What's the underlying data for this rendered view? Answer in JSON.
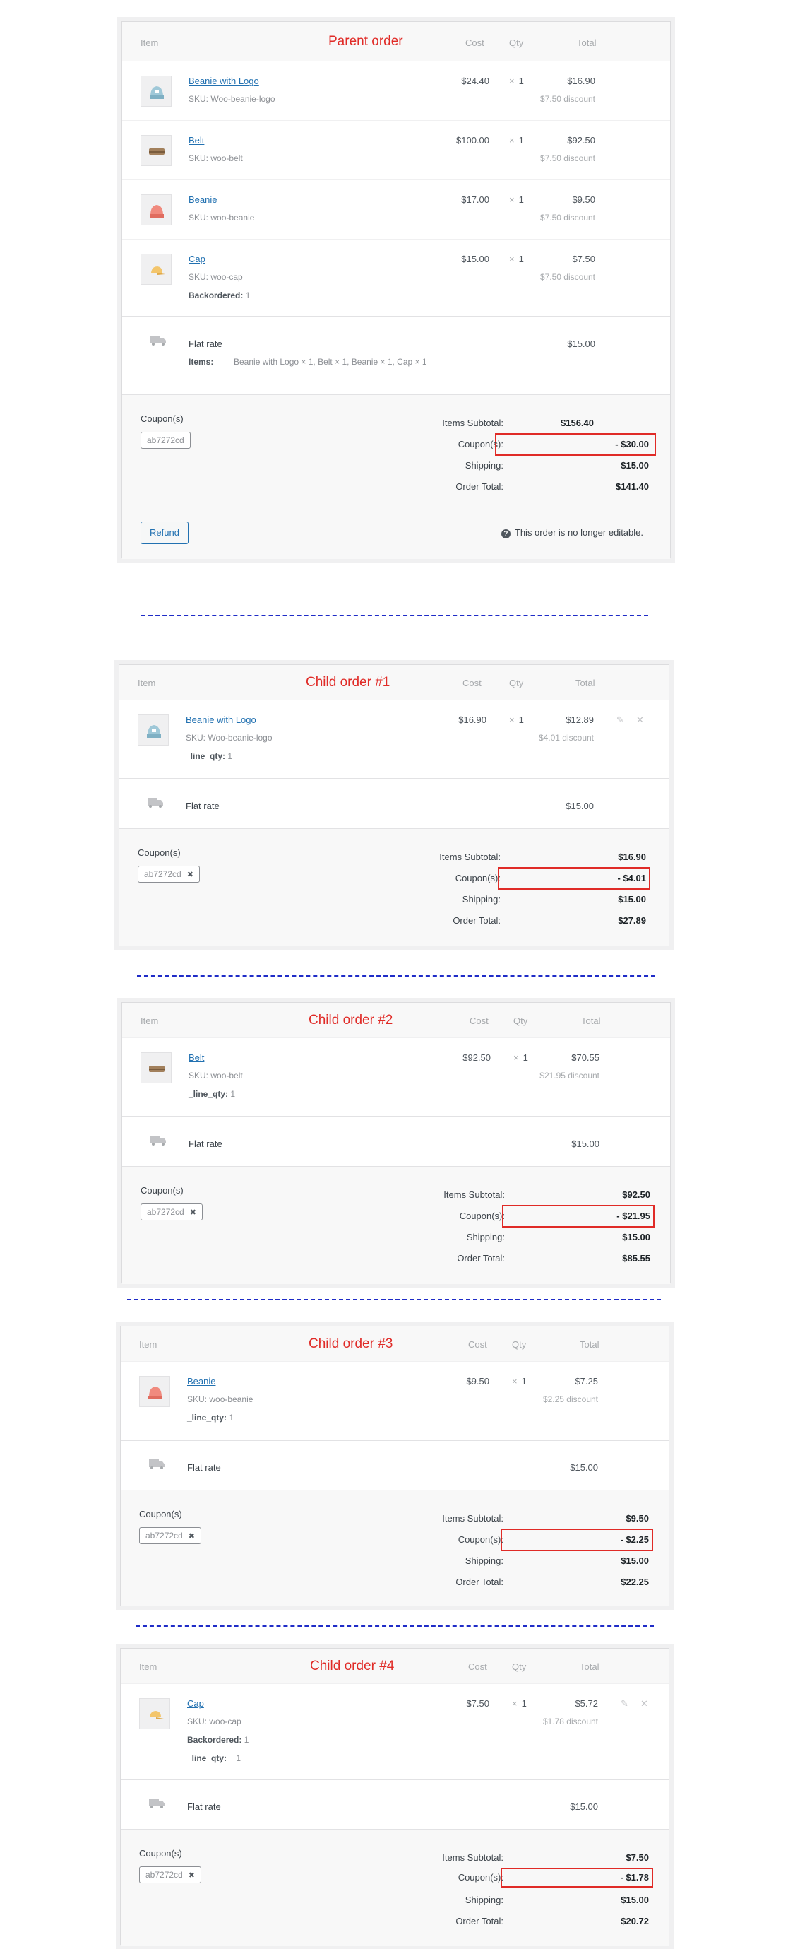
{
  "columns": {
    "item": "Item",
    "cost": "Cost",
    "qty": "Qty",
    "total": "Total"
  },
  "parent": {
    "title": "Parent order",
    "items": [
      {
        "name": "Beanie with Logo",
        "sku_label": "SKU:",
        "sku": "Woo-beanie-logo",
        "cost": "$24.40",
        "qty": "1",
        "total": "$16.90",
        "discount": "$7.50 discount",
        "thumb": "beanie-logo-icon"
      },
      {
        "name": "Belt",
        "sku_label": "SKU:",
        "sku": "woo-belt",
        "cost": "$100.00",
        "qty": "1",
        "total": "$92.50",
        "discount": "$7.50 discount",
        "thumb": "belt-icon"
      },
      {
        "name": "Beanie",
        "sku_label": "SKU:",
        "sku": "woo-beanie",
        "cost": "$17.00",
        "qty": "1",
        "total": "$9.50",
        "discount": "$7.50 discount",
        "thumb": "beanie-icon"
      },
      {
        "name": "Cap",
        "sku_label": "SKU:",
        "sku": "woo-cap",
        "backorder_label": "Backordered:",
        "backorder": "1",
        "cost": "$15.00",
        "qty": "1",
        "total": "$7.50",
        "discount": "$7.50 discount",
        "thumb": "cap-icon"
      }
    ],
    "shipping": {
      "name": "Flat rate",
      "items_label": "Items:",
      "items": "Beanie with Logo × 1, Belt × 1, Beanie × 1, Cap × 1",
      "total": "$15.00"
    },
    "coupons_label": "Coupon(s)",
    "coupon_code": "ab7272cd",
    "totals": {
      "items_subtotal_label": "Items Subtotal:",
      "items_subtotal": "$156.40",
      "coupons_label": "Coupon(s):",
      "coupons": "- $30.00",
      "shipping_label": "Shipping:",
      "shipping": "$15.00",
      "order_total_label": "Order Total:",
      "order_total": "$141.40"
    },
    "refund_label": "Refund",
    "not_editable": "This order is no longer editable."
  },
  "children": [
    {
      "title": "Child order #1",
      "item": {
        "name": "Beanie with Logo",
        "sku_label": "SKU:",
        "sku": "Woo-beanie-logo",
        "line_qty_label": "_line_qty:",
        "line_qty": "1",
        "cost": "$16.90",
        "qty": "1",
        "total": "$12.89",
        "discount": "$4.01 discount",
        "thumb": "beanie-logo-icon"
      },
      "shipping": {
        "name": "Flat rate",
        "total": "$15.00"
      },
      "coupons_label": "Coupon(s)",
      "coupon_code": "ab7272cd",
      "totals": {
        "items_subtotal_label": "Items Subtotal:",
        "items_subtotal": "$16.90",
        "coupons_label": "Coupon(s):",
        "coupons": "- $4.01",
        "shipping_label": "Shipping:",
        "shipping": "$15.00",
        "order_total_label": "Order Total:",
        "order_total": "$27.89"
      }
    },
    {
      "title": "Child order #2",
      "item": {
        "name": "Belt",
        "sku_label": "SKU:",
        "sku": "woo-belt",
        "line_qty_label": "_line_qty:",
        "line_qty": "1",
        "cost": "$92.50",
        "qty": "1",
        "total": "$70.55",
        "discount": "$21.95 discount",
        "thumb": "belt-icon"
      },
      "shipping": {
        "name": "Flat rate",
        "total": "$15.00"
      },
      "coupons_label": "Coupon(s)",
      "coupon_code": "ab7272cd",
      "totals": {
        "items_subtotal_label": "Items Subtotal:",
        "items_subtotal": "$92.50",
        "coupons_label": "Coupon(s):",
        "coupons": "- $21.95",
        "shipping_label": "Shipping:",
        "shipping": "$15.00",
        "order_total_label": "Order Total:",
        "order_total": "$85.55"
      }
    },
    {
      "title": "Child order #3",
      "item": {
        "name": "Beanie",
        "sku_label": "SKU:",
        "sku": "woo-beanie",
        "line_qty_label": "_line_qty:",
        "line_qty": "1",
        "cost": "$9.50",
        "qty": "1",
        "total": "$7.25",
        "discount": "$2.25 discount",
        "thumb": "beanie-icon"
      },
      "shipping": {
        "name": "Flat rate",
        "total": "$15.00"
      },
      "coupons_label": "Coupon(s)",
      "coupon_code": "ab7272cd",
      "totals": {
        "items_subtotal_label": "Items Subtotal:",
        "items_subtotal": "$9.50",
        "coupons_label": "Coupon(s):",
        "coupons": "- $2.25",
        "shipping_label": "Shipping:",
        "shipping": "$15.00",
        "order_total_label": "Order Total:",
        "order_total": "$22.25"
      }
    },
    {
      "title": "Child order #4",
      "item": {
        "name": "Cap",
        "sku_label": "SKU:",
        "sku": "woo-cap",
        "backorder_label": "Backordered:",
        "backorder": "1",
        "line_qty_label": "_line_qty:",
        "line_qty": "1",
        "cost": "$7.50",
        "qty": "1",
        "total": "$5.72",
        "discount": "$1.78 discount",
        "thumb": "cap-icon"
      },
      "shipping": {
        "name": "Flat rate",
        "total": "$15.00"
      },
      "coupons_label": "Coupon(s)",
      "coupon_code": "ab7272cd",
      "totals": {
        "items_subtotal_label": "Items Subtotal:",
        "items_subtotal": "$7.50",
        "coupons_label": "Coupon(s):",
        "coupons": "- $1.78",
        "shipping_label": "Shipping:",
        "shipping": "$15.00",
        "order_total_label": "Order Total:",
        "order_total": "$20.72"
      }
    }
  ],
  "colors": {
    "accent": "#e02b27",
    "link": "#2271b1",
    "divider": "#1f2cc7"
  }
}
